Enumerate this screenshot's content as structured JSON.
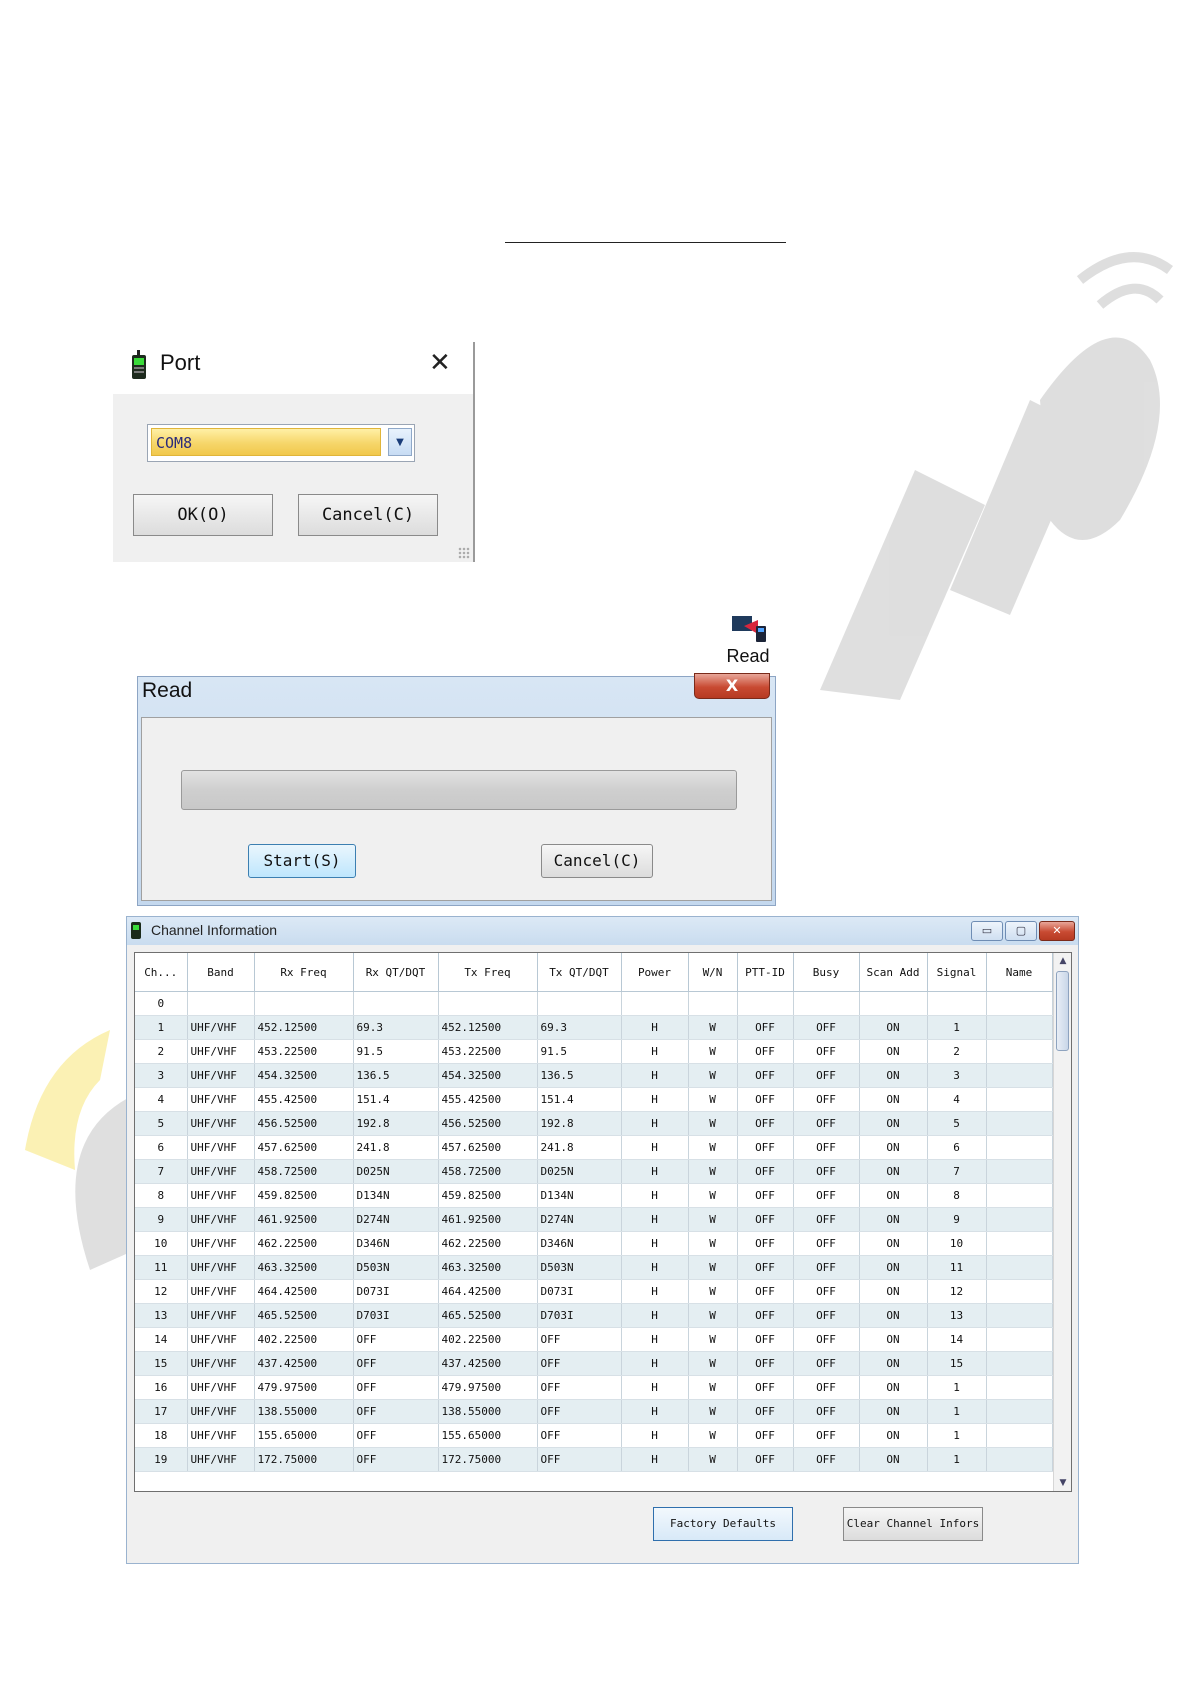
{
  "port_dialog": {
    "title": "Port",
    "close_glyph": "✕",
    "selected_port": "COM8",
    "ok_label": "OK(O)",
    "cancel_label": "Cancel(C)"
  },
  "toolbar_read": {
    "label": "Read",
    "icon": "read-radio-icon"
  },
  "read_dialog": {
    "title": "Read",
    "close_glyph": "X",
    "progress": 0,
    "start_label": "Start(S)",
    "cancel_label": "Cancel(C)"
  },
  "channel_window": {
    "title": "Channel Information",
    "min_glyph": "▭",
    "max_glyph": "▢",
    "close_glyph": "✕",
    "columns": [
      "Ch...",
      "Band",
      "Rx Freq",
      "Rx QT/DQT",
      "Tx Freq",
      "Tx QT/DQT",
      "Power",
      "W/N",
      "PTT-ID",
      "Busy",
      "Scan Add",
      "Signal",
      "Name"
    ],
    "rows": [
      [
        "0",
        "",
        "",
        "",
        "",
        "",
        "",
        "",
        "",
        "",
        "",
        "",
        ""
      ],
      [
        "1",
        "UHF/VHF",
        "452.12500",
        "69.3",
        "452.12500",
        "69.3",
        "H",
        "W",
        "OFF",
        "OFF",
        "ON",
        "1",
        ""
      ],
      [
        "2",
        "UHF/VHF",
        "453.22500",
        "91.5",
        "453.22500",
        "91.5",
        "H",
        "W",
        "OFF",
        "OFF",
        "ON",
        "2",
        ""
      ],
      [
        "3",
        "UHF/VHF",
        "454.32500",
        "136.5",
        "454.32500",
        "136.5",
        "H",
        "W",
        "OFF",
        "OFF",
        "ON",
        "3",
        ""
      ],
      [
        "4",
        "UHF/VHF",
        "455.42500",
        "151.4",
        "455.42500",
        "151.4",
        "H",
        "W",
        "OFF",
        "OFF",
        "ON",
        "4",
        ""
      ],
      [
        "5",
        "UHF/VHF",
        "456.52500",
        "192.8",
        "456.52500",
        "192.8",
        "H",
        "W",
        "OFF",
        "OFF",
        "ON",
        "5",
        ""
      ],
      [
        "6",
        "UHF/VHF",
        "457.62500",
        "241.8",
        "457.62500",
        "241.8",
        "H",
        "W",
        "OFF",
        "OFF",
        "ON",
        "6",
        ""
      ],
      [
        "7",
        "UHF/VHF",
        "458.72500",
        "D025N",
        "458.72500",
        "D025N",
        "H",
        "W",
        "OFF",
        "OFF",
        "ON",
        "7",
        ""
      ],
      [
        "8",
        "UHF/VHF",
        "459.82500",
        "D134N",
        "459.82500",
        "D134N",
        "H",
        "W",
        "OFF",
        "OFF",
        "ON",
        "8",
        ""
      ],
      [
        "9",
        "UHF/VHF",
        "461.92500",
        "D274N",
        "461.92500",
        "D274N",
        "H",
        "W",
        "OFF",
        "OFF",
        "ON",
        "9",
        ""
      ],
      [
        "10",
        "UHF/VHF",
        "462.22500",
        "D346N",
        "462.22500",
        "D346N",
        "H",
        "W",
        "OFF",
        "OFF",
        "ON",
        "10",
        ""
      ],
      [
        "11",
        "UHF/VHF",
        "463.32500",
        "D503N",
        "463.32500",
        "D503N",
        "H",
        "W",
        "OFF",
        "OFF",
        "ON",
        "11",
        ""
      ],
      [
        "12",
        "UHF/VHF",
        "464.42500",
        "D073I",
        "464.42500",
        "D073I",
        "H",
        "W",
        "OFF",
        "OFF",
        "ON",
        "12",
        ""
      ],
      [
        "13",
        "UHF/VHF",
        "465.52500",
        "D703I",
        "465.52500",
        "D703I",
        "H",
        "W",
        "OFF",
        "OFF",
        "ON",
        "13",
        ""
      ],
      [
        "14",
        "UHF/VHF",
        "402.22500",
        "OFF",
        "402.22500",
        "OFF",
        "H",
        "W",
        "OFF",
        "OFF",
        "ON",
        "14",
        ""
      ],
      [
        "15",
        "UHF/VHF",
        "437.42500",
        "OFF",
        "437.42500",
        "OFF",
        "H",
        "W",
        "OFF",
        "OFF",
        "ON",
        "15",
        ""
      ],
      [
        "16",
        "UHF/VHF",
        "479.97500",
        "OFF",
        "479.97500",
        "OFF",
        "H",
        "W",
        "OFF",
        "OFF",
        "ON",
        "1",
        ""
      ],
      [
        "17",
        "UHF/VHF",
        "138.55000",
        "OFF",
        "138.55000",
        "OFF",
        "H",
        "W",
        "OFF",
        "OFF",
        "ON",
        "1",
        ""
      ],
      [
        "18",
        "UHF/VHF",
        "155.65000",
        "OFF",
        "155.65000",
        "OFF",
        "H",
        "W",
        "OFF",
        "OFF",
        "ON",
        "1",
        ""
      ],
      [
        "19",
        "UHF/VHF",
        "172.75000",
        "OFF",
        "172.75000",
        "OFF",
        "H",
        "W",
        "OFF",
        "OFF",
        "ON",
        "1",
        ""
      ]
    ],
    "factory_defaults_label": "Factory Defaults",
    "clear_channel_label": "Clear Channel Infors"
  },
  "colors": {
    "selected_combo": "#f6d66a",
    "row_alt": "#e4eef2",
    "titlebar": "#c9dcef",
    "close_red": "#c84a32"
  }
}
